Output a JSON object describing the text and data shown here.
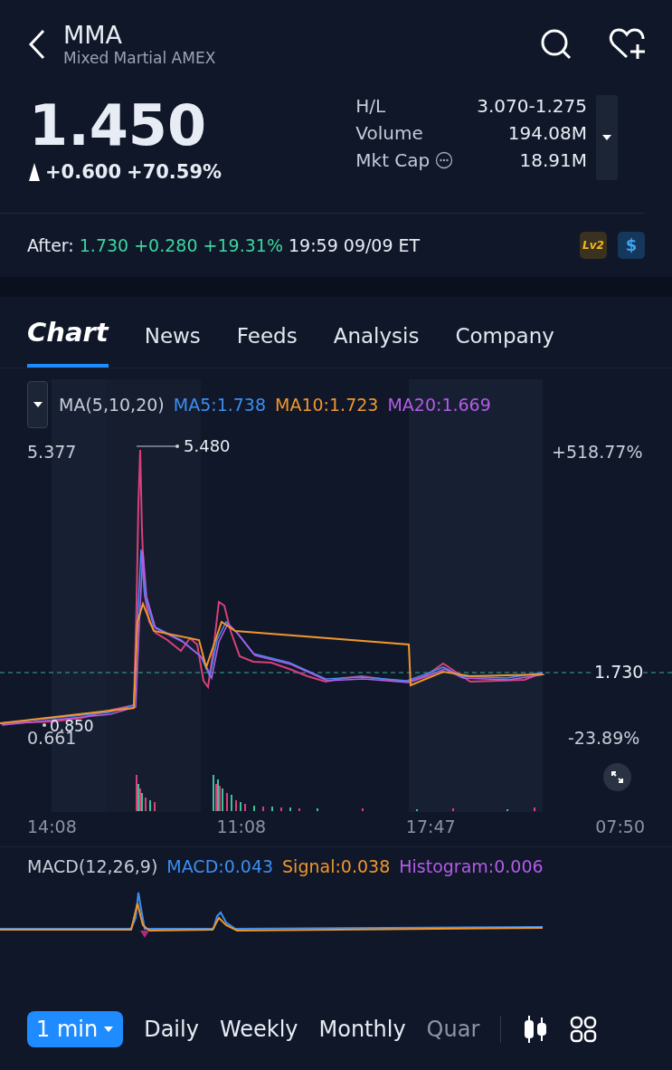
{
  "header": {
    "symbol": "MMA",
    "name": "Mixed Martial AMEX"
  },
  "quote": {
    "price": "1.450",
    "change": "+0.600",
    "change_pct": "+70.59%"
  },
  "stats": [
    {
      "label": "H/L",
      "value": "3.070-1.275",
      "info": false
    },
    {
      "label": "Volume",
      "value": "194.08M",
      "info": false
    },
    {
      "label": "Mkt Cap",
      "value": "18.91M",
      "info": true
    }
  ],
  "after_hours": {
    "label": "After:",
    "price": "1.730",
    "change": "+0.280",
    "change_pct": "+19.31%",
    "time": "19:59 09/09 ET"
  },
  "badges": [
    {
      "text": "Lv2",
      "kind": "level"
    },
    {
      "text": "$",
      "kind": "dollar"
    }
  ],
  "tabs": [
    {
      "label": "Chart",
      "selected": true
    },
    {
      "label": "News",
      "selected": false
    },
    {
      "label": "Feeds",
      "selected": false
    },
    {
      "label": "Analysis",
      "selected": false
    },
    {
      "label": "Company",
      "selected": false
    }
  ],
  "indicator": {
    "name": "MA(5,10,20)",
    "values": [
      {
        "text": "MA5:1.738",
        "color": "#3d8ef0"
      },
      {
        "text": "MA10:1.723",
        "color": "#f0962e"
      },
      {
        "text": "MA20:1.669",
        "color": "#b45ce6"
      }
    ]
  },
  "price_chart": {
    "high_label": "5.377",
    "low_label": "0.661",
    "peak_label": "5.480",
    "low_mark": "0.850",
    "high_pct": "+518.77%",
    "low_pct": "-23.89%",
    "last": "1.730"
  },
  "x_axis": [
    "14:08",
    "11:08",
    "17:47",
    "07:50"
  ],
  "macd": {
    "name": "MACD(12,26,9)",
    "values": [
      {
        "text": "MACD:0.043",
        "color": "#3d8ef0"
      },
      {
        "text": "Signal:0.038",
        "color": "#f0962e"
      },
      {
        "text": "Histogram:0.006",
        "color": "#b45ce6"
      }
    ]
  },
  "periods": [
    {
      "label": "1 min",
      "selected": true
    },
    {
      "label": "Daily",
      "selected": false
    },
    {
      "label": "Weekly",
      "selected": false
    },
    {
      "label": "Monthly",
      "selected": false
    },
    {
      "label": "Quar",
      "selected": false
    }
  ]
}
